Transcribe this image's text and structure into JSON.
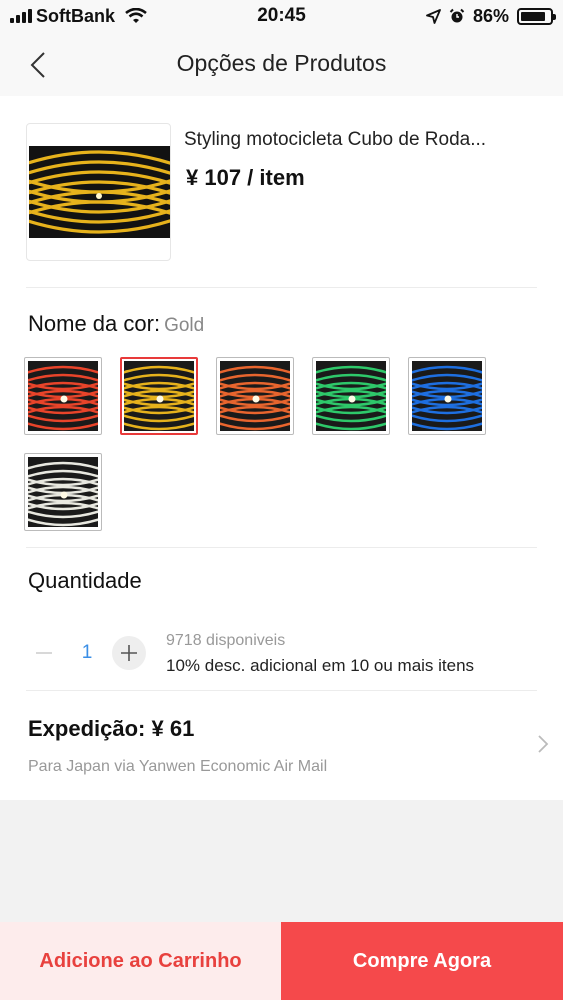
{
  "status_bar": {
    "carrier": "SoftBank",
    "time": "20:45",
    "battery": "86%",
    "battery_level": 0.86,
    "icons": [
      "signal-icon",
      "wifi-icon",
      "location-icon",
      "alarm-icon",
      "battery-icon"
    ]
  },
  "nav": {
    "title": "Opções de Produtos",
    "back_icon": "chevron-left-icon"
  },
  "product": {
    "title": "Styling motocicleta Cubo de Roda...",
    "price": "¥ 107 / item"
  },
  "color": {
    "label": "Nome da cor:",
    "selected": "Gold",
    "options": [
      {
        "name": "Red",
        "color": "#e8442a"
      },
      {
        "name": "Gold",
        "color": "#e6b21c"
      },
      {
        "name": "Orange",
        "color": "#e8652e"
      },
      {
        "name": "Green",
        "color": "#2ec86a"
      },
      {
        "name": "Blue",
        "color": "#1e6fe0"
      },
      {
        "name": "White",
        "color": "#e8e8e0"
      }
    ]
  },
  "quantity": {
    "label": "Quantidade",
    "value": "1",
    "stock": "9718 disponiveis",
    "discount": "10% desc. adicional em 10 ou mais itens"
  },
  "shipping": {
    "title": "Expedição: ¥ 61",
    "subtitle": "Para Japan via Yanwen Economic Air Mail"
  },
  "actions": {
    "add_to_cart": "Adicione ao Carrinho",
    "buy_now": "Compre Agora"
  },
  "colors": {
    "accent_red": "#f5494b",
    "qty_blue": "#3a8ee6"
  }
}
